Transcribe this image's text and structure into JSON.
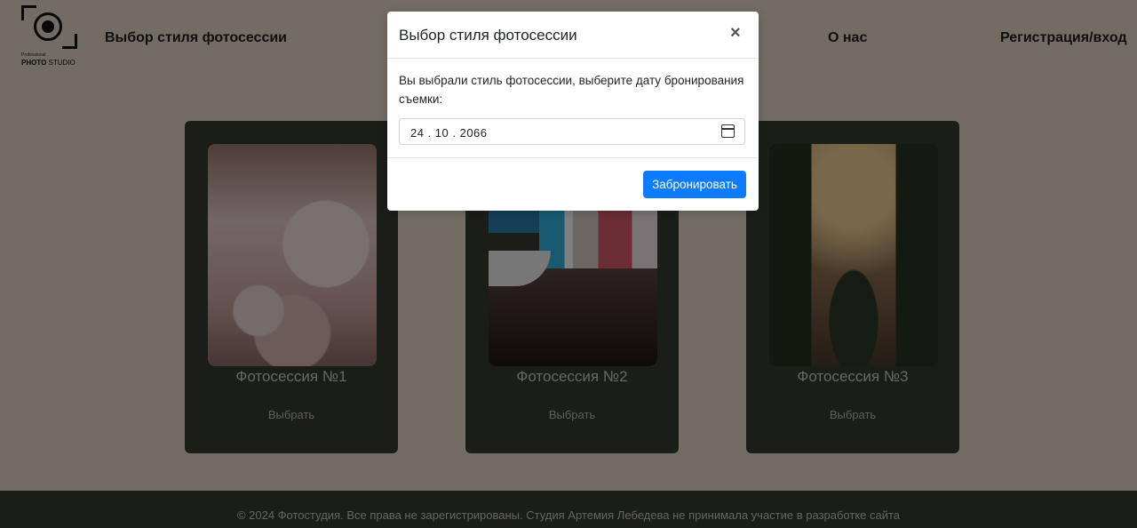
{
  "header": {
    "logo_small": "Professional",
    "logo_brand_bold": "PHOTO",
    "logo_brand_rest": "STUDIO",
    "nav_styles": "Выбор стиля фотосессии",
    "nav_about": "О нас",
    "nav_auth": "Регистрация/вход"
  },
  "cards": [
    {
      "title": "Фотосессия №1",
      "select_label": "Выбрать"
    },
    {
      "title": "Фотосессия №2",
      "select_label": "Выбрать"
    },
    {
      "title": "Фотосессия №3",
      "select_label": "Выбрать"
    }
  ],
  "footer": {
    "text": "© 2024 Фотостудия. Все права не зарегистрированы. Студия Артемия Лебедева не принимала участие в разработке сайта"
  },
  "modal": {
    "title": "Выбор стиля фотосессии",
    "close_label": "×",
    "message": "Вы выбрали стиль фотосессии, выберите дату бронирования съемки:",
    "date_value": "24 . 10 . 2066",
    "submit_label": "Забронировать"
  },
  "colors": {
    "page_background": "#e5d9c9",
    "card_background": "#343a30",
    "primary_button": "#0d7bfd"
  }
}
